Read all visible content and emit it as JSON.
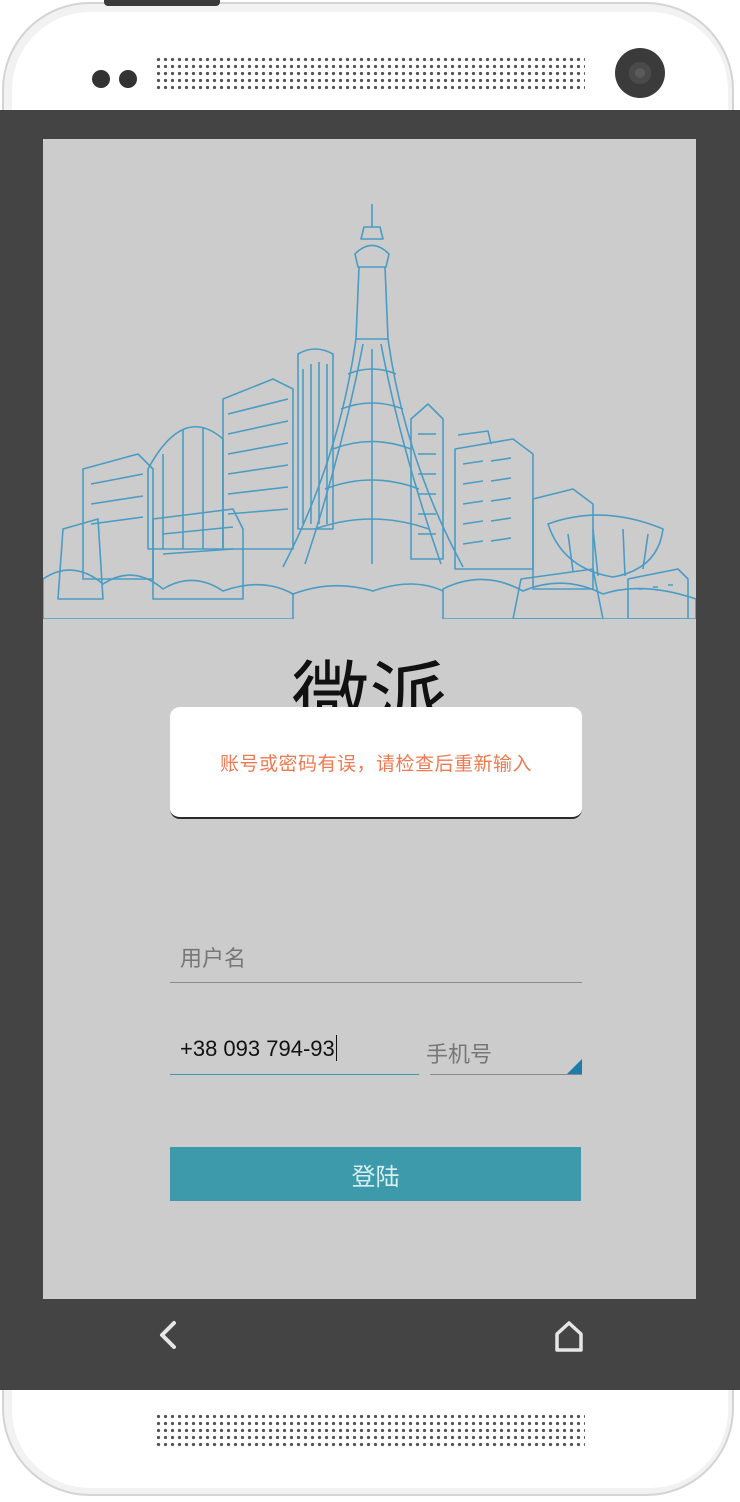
{
  "app": {
    "title": "微派"
  },
  "toast": {
    "message": "账号或密码有误，请检查后重新输入",
    "color": "#ee7a52"
  },
  "form": {
    "username_placeholder": "用户名",
    "phone_value": "+38 093 794-93",
    "phone_type_label": "手机号",
    "login_label": "登陆"
  },
  "colors": {
    "accent": "#3c9aaa",
    "screen_bg": "#cccccc",
    "frame": "#444444"
  },
  "nav": {
    "back_icon": "back-chevron-icon",
    "home_icon": "home-icon"
  }
}
